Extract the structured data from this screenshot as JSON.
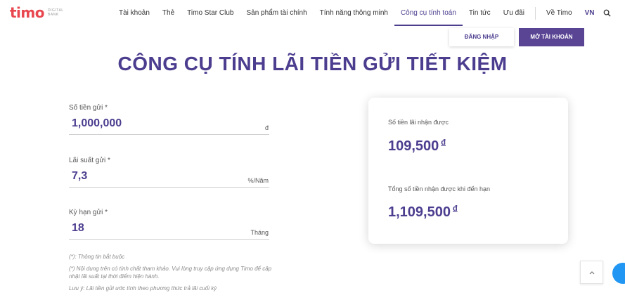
{
  "brand": {
    "logo_text": "timo",
    "logo_sub": "DIGITAL BANK",
    "accent": "#4c3d8f",
    "logo_red": "#e8474f"
  },
  "nav": {
    "items": [
      {
        "label": "Tài khoản"
      },
      {
        "label": "Thẻ"
      },
      {
        "label": "Timo Star Club"
      },
      {
        "label": "Sản phẩm tài chính"
      },
      {
        "label": "Tính năng thông minh"
      },
      {
        "label": "Công cụ tính toán",
        "active": true
      },
      {
        "label": "Tin tức"
      },
      {
        "label": "Ưu đãi"
      }
    ],
    "about": "Về Timo",
    "lang": "VN",
    "search_icon": "search-icon"
  },
  "buttons": {
    "login": "ĐĂNG NHẬP",
    "open_account": "MỞ TÀI KHOẢN"
  },
  "page_title": "CÔNG CỤ TÍNH LÃI TIỀN GỬI TIẾT KIỆM",
  "form": {
    "deposit": {
      "label": "Số tiền gửi *",
      "value": "1,000,000",
      "unit": "đ"
    },
    "rate": {
      "label": "Lãi suất gửi *",
      "value": "7,3",
      "unit": "%/Năm"
    },
    "term": {
      "label": "Kỳ hạn gửi *",
      "value": "18",
      "unit": "Tháng"
    }
  },
  "notes": [
    "(*): Thông tin bắt buộc",
    "(*) Nội dung trên có tính chất tham khảo. Vui lòng truy cập ứng dụng Timo để cập nhật lãi suất tại thời điểm hiện hành.",
    "Lưu ý: Lãi tiền gửi ước tính theo phương thức trả lãi cuối kỳ"
  ],
  "result": {
    "interest_label": "Số tiền lãi nhận được",
    "interest_value": "109,500",
    "total_label": "Tổng số tiền nhận được khi đến hạn",
    "total_value": "1,109,500",
    "currency": "đ"
  }
}
